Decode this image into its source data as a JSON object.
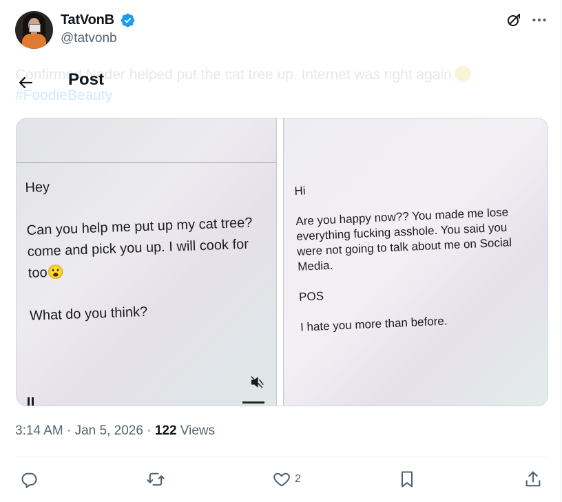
{
  "author": {
    "name": "TatVonB",
    "handle": "@tatvonb"
  },
  "header": {
    "back_label": "Back",
    "title": "Post"
  },
  "tweet": {
    "text": "Confirmed Nader helped put the cat tree up. Internet was right again",
    "hashtag": "#FoodieBeauty"
  },
  "media": {
    "left_note": "Hey\n\nCan you help me put up my cat tree?\ncome and pick you up.   I will cook for\ntoo😮\n\nWhat do you think?",
    "right_note": "Hi\n\nAre you happy now?? You made me lose\neverything fucking asshole.  You said you\nwere not going to talk about me on Social\nMedia.\n\nPOS\n\nI hate you more than before."
  },
  "meta": {
    "time": "3:14 AM",
    "dot1": "·",
    "date": "Jan 5, 2026",
    "dot2": "·",
    "views_count": "122",
    "views_label": "Views"
  },
  "actions": {
    "like_count": "2"
  },
  "colors": {
    "accent": "#1d9bf0",
    "secondary_text": "#536471",
    "primary_text": "#0f1419"
  },
  "icons": {
    "verified": "verified-badge-icon",
    "grok": "grok-icon",
    "more": "more-icon",
    "back": "back-arrow-icon",
    "reply": "reply-icon",
    "repost": "repost-icon",
    "like": "heart-icon",
    "bookmark": "bookmark-icon",
    "share": "share-icon"
  }
}
